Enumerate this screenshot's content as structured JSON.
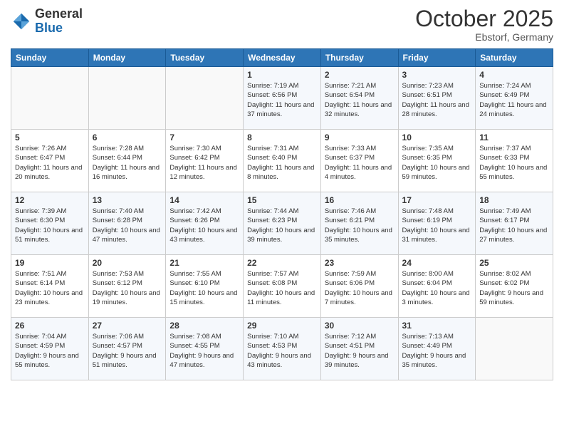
{
  "branding": {
    "general": "General",
    "blue": "Blue"
  },
  "header": {
    "title": "October 2025",
    "location": "Ebstorf, Germany"
  },
  "weekdays": [
    "Sunday",
    "Monday",
    "Tuesday",
    "Wednesday",
    "Thursday",
    "Friday",
    "Saturday"
  ],
  "weeks": [
    [
      {
        "day": "",
        "sunrise": "",
        "sunset": "",
        "daylight": ""
      },
      {
        "day": "",
        "sunrise": "",
        "sunset": "",
        "daylight": ""
      },
      {
        "day": "",
        "sunrise": "",
        "sunset": "",
        "daylight": ""
      },
      {
        "day": "1",
        "sunrise": "Sunrise: 7:19 AM",
        "sunset": "Sunset: 6:56 PM",
        "daylight": "Daylight: 11 hours and 37 minutes."
      },
      {
        "day": "2",
        "sunrise": "Sunrise: 7:21 AM",
        "sunset": "Sunset: 6:54 PM",
        "daylight": "Daylight: 11 hours and 32 minutes."
      },
      {
        "day": "3",
        "sunrise": "Sunrise: 7:23 AM",
        "sunset": "Sunset: 6:51 PM",
        "daylight": "Daylight: 11 hours and 28 minutes."
      },
      {
        "day": "4",
        "sunrise": "Sunrise: 7:24 AM",
        "sunset": "Sunset: 6:49 PM",
        "daylight": "Daylight: 11 hours and 24 minutes."
      }
    ],
    [
      {
        "day": "5",
        "sunrise": "Sunrise: 7:26 AM",
        "sunset": "Sunset: 6:47 PM",
        "daylight": "Daylight: 11 hours and 20 minutes."
      },
      {
        "day": "6",
        "sunrise": "Sunrise: 7:28 AM",
        "sunset": "Sunset: 6:44 PM",
        "daylight": "Daylight: 11 hours and 16 minutes."
      },
      {
        "day": "7",
        "sunrise": "Sunrise: 7:30 AM",
        "sunset": "Sunset: 6:42 PM",
        "daylight": "Daylight: 11 hours and 12 minutes."
      },
      {
        "day": "8",
        "sunrise": "Sunrise: 7:31 AM",
        "sunset": "Sunset: 6:40 PM",
        "daylight": "Daylight: 11 hours and 8 minutes."
      },
      {
        "day": "9",
        "sunrise": "Sunrise: 7:33 AM",
        "sunset": "Sunset: 6:37 PM",
        "daylight": "Daylight: 11 hours and 4 minutes."
      },
      {
        "day": "10",
        "sunrise": "Sunrise: 7:35 AM",
        "sunset": "Sunset: 6:35 PM",
        "daylight": "Daylight: 10 hours and 59 minutes."
      },
      {
        "day": "11",
        "sunrise": "Sunrise: 7:37 AM",
        "sunset": "Sunset: 6:33 PM",
        "daylight": "Daylight: 10 hours and 55 minutes."
      }
    ],
    [
      {
        "day": "12",
        "sunrise": "Sunrise: 7:39 AM",
        "sunset": "Sunset: 6:30 PM",
        "daylight": "Daylight: 10 hours and 51 minutes."
      },
      {
        "day": "13",
        "sunrise": "Sunrise: 7:40 AM",
        "sunset": "Sunset: 6:28 PM",
        "daylight": "Daylight: 10 hours and 47 minutes."
      },
      {
        "day": "14",
        "sunrise": "Sunrise: 7:42 AM",
        "sunset": "Sunset: 6:26 PM",
        "daylight": "Daylight: 10 hours and 43 minutes."
      },
      {
        "day": "15",
        "sunrise": "Sunrise: 7:44 AM",
        "sunset": "Sunset: 6:23 PM",
        "daylight": "Daylight: 10 hours and 39 minutes."
      },
      {
        "day": "16",
        "sunrise": "Sunrise: 7:46 AM",
        "sunset": "Sunset: 6:21 PM",
        "daylight": "Daylight: 10 hours and 35 minutes."
      },
      {
        "day": "17",
        "sunrise": "Sunrise: 7:48 AM",
        "sunset": "Sunset: 6:19 PM",
        "daylight": "Daylight: 10 hours and 31 minutes."
      },
      {
        "day": "18",
        "sunrise": "Sunrise: 7:49 AM",
        "sunset": "Sunset: 6:17 PM",
        "daylight": "Daylight: 10 hours and 27 minutes."
      }
    ],
    [
      {
        "day": "19",
        "sunrise": "Sunrise: 7:51 AM",
        "sunset": "Sunset: 6:14 PM",
        "daylight": "Daylight: 10 hours and 23 minutes."
      },
      {
        "day": "20",
        "sunrise": "Sunrise: 7:53 AM",
        "sunset": "Sunset: 6:12 PM",
        "daylight": "Daylight: 10 hours and 19 minutes."
      },
      {
        "day": "21",
        "sunrise": "Sunrise: 7:55 AM",
        "sunset": "Sunset: 6:10 PM",
        "daylight": "Daylight: 10 hours and 15 minutes."
      },
      {
        "day": "22",
        "sunrise": "Sunrise: 7:57 AM",
        "sunset": "Sunset: 6:08 PM",
        "daylight": "Daylight: 10 hours and 11 minutes."
      },
      {
        "day": "23",
        "sunrise": "Sunrise: 7:59 AM",
        "sunset": "Sunset: 6:06 PM",
        "daylight": "Daylight: 10 hours and 7 minutes."
      },
      {
        "day": "24",
        "sunrise": "Sunrise: 8:00 AM",
        "sunset": "Sunset: 6:04 PM",
        "daylight": "Daylight: 10 hours and 3 minutes."
      },
      {
        "day": "25",
        "sunrise": "Sunrise: 8:02 AM",
        "sunset": "Sunset: 6:02 PM",
        "daylight": "Daylight: 9 hours and 59 minutes."
      }
    ],
    [
      {
        "day": "26",
        "sunrise": "Sunrise: 7:04 AM",
        "sunset": "Sunset: 4:59 PM",
        "daylight": "Daylight: 9 hours and 55 minutes."
      },
      {
        "day": "27",
        "sunrise": "Sunrise: 7:06 AM",
        "sunset": "Sunset: 4:57 PM",
        "daylight": "Daylight: 9 hours and 51 minutes."
      },
      {
        "day": "28",
        "sunrise": "Sunrise: 7:08 AM",
        "sunset": "Sunset: 4:55 PM",
        "daylight": "Daylight: 9 hours and 47 minutes."
      },
      {
        "day": "29",
        "sunrise": "Sunrise: 7:10 AM",
        "sunset": "Sunset: 4:53 PM",
        "daylight": "Daylight: 9 hours and 43 minutes."
      },
      {
        "day": "30",
        "sunrise": "Sunrise: 7:12 AM",
        "sunset": "Sunset: 4:51 PM",
        "daylight": "Daylight: 9 hours and 39 minutes."
      },
      {
        "day": "31",
        "sunrise": "Sunrise: 7:13 AM",
        "sunset": "Sunset: 4:49 PM",
        "daylight": "Daylight: 9 hours and 35 minutes."
      },
      {
        "day": "",
        "sunrise": "",
        "sunset": "",
        "daylight": ""
      }
    ]
  ]
}
